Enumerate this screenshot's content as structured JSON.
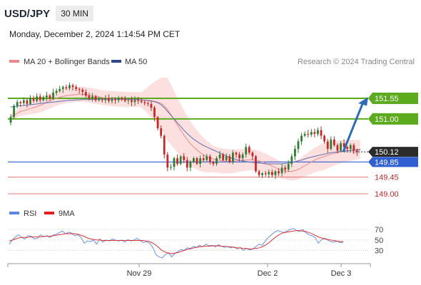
{
  "header": {
    "symbol": "USD/JPY",
    "timeframe": "30 MIN",
    "datetime": "Monday, December 2, 2024 1:14:54 PM CET"
  },
  "legend": {
    "ma20_bb_label": "MA 20 + Bollinger Bands",
    "ma50_label": "MA 50",
    "credit": "Research © 2024 Trading Central",
    "rsi_label": "RSI",
    "rsi_ma_label": "9MA"
  },
  "colors": {
    "bull": "#2e7d32",
    "bear": "#c62828",
    "ma20": "#e88a8a",
    "ma50": "#5a6fb5",
    "band_fill": "#fbd9d9",
    "resistance": "#5cab1e",
    "support": "#2f5fd0",
    "target_line": "#e05050",
    "arrow": "#2d6bb5",
    "rsi": "#5b86e5",
    "rsi_ma": "#e02020"
  },
  "chart_data": [
    {
      "type": "candlestick",
      "title": "USD/JPY 30 MIN",
      "x_tick_labels": [
        "Nov 29",
        "Dec 2",
        "Dec 3"
      ],
      "ylim": [
        148.7,
        152.3
      ],
      "levels": [
        {
          "value": 151.55,
          "label": "151.55",
          "kind": "resistance"
        },
        {
          "value": 151.0,
          "label": "151.00",
          "kind": "resistance"
        },
        {
          "value": 150.12,
          "label": "150.12",
          "kind": "current_price"
        },
        {
          "value": 149.85,
          "label": "149.85",
          "kind": "pivot_support"
        },
        {
          "value": 149.45,
          "label": "149.45",
          "kind": "support"
        },
        {
          "value": 149.0,
          "label": "149.00",
          "kind": "support"
        }
      ],
      "series": [
        {
          "name": "MA 20 + Bollinger Bands",
          "values": [
            151.05,
            151.1,
            151.15,
            151.2,
            151.22,
            151.25,
            151.28,
            151.3,
            151.33,
            151.36,
            151.4,
            151.45,
            151.48,
            151.52,
            151.55,
            151.58,
            151.6,
            151.62,
            151.63,
            151.64,
            151.65,
            151.66,
            151.66,
            151.65,
            151.63,
            151.62,
            151.6,
            151.59,
            151.57,
            151.56,
            151.55,
            151.54,
            151.54,
            151.53,
            151.53,
            151.52,
            151.52,
            151.52,
            151.52,
            151.52,
            151.51,
            151.5,
            151.5,
            151.49,
            151.47,
            151.45,
            151.42,
            151.35,
            151.25,
            151.12,
            150.98,
            150.84,
            150.7,
            150.57,
            150.45,
            150.34,
            150.25,
            150.17,
            150.1,
            150.04,
            149.99,
            149.96,
            149.93,
            149.91,
            149.89,
            149.88,
            149.87,
            149.87,
            149.87,
            149.88,
            149.89,
            149.9,
            149.9,
            149.91,
            149.91,
            149.9,
            149.88,
            149.85,
            149.82,
            149.78,
            149.74,
            149.7,
            149.66,
            149.63,
            149.61,
            149.6,
            149.6,
            149.62,
            149.65,
            149.7,
            149.75,
            149.8,
            149.85,
            149.9,
            149.94,
            149.97,
            150.0,
            150.03,
            150.06,
            150.08,
            150.1,
            150.12,
            150.14,
            150.15,
            150.16,
            150.17,
            150.18,
            150.19
          ]
        },
        {
          "name": "MA 50",
          "values": [
            151.32,
            151.33,
            151.34,
            151.35,
            151.36,
            151.37,
            151.38,
            151.39,
            151.4,
            151.41,
            151.42,
            151.43,
            151.44,
            151.45,
            151.46,
            151.47,
            151.48,
            151.49,
            151.5,
            151.5,
            151.51,
            151.51,
            151.52,
            151.52,
            151.52,
            151.52,
            151.53,
            151.53,
            151.53,
            151.53,
            151.53,
            151.53,
            151.53,
            151.53,
            151.53,
            151.53,
            151.53,
            151.52,
            151.52,
            151.52,
            151.51,
            151.5,
            151.49,
            151.48,
            151.46,
            151.43,
            151.38,
            151.3,
            151.2,
            151.1,
            151.0,
            150.9,
            150.8,
            150.7,
            150.61,
            150.53,
            150.46,
            150.4,
            150.34,
            150.29,
            150.25,
            150.21,
            150.17,
            150.13,
            150.09,
            150.05,
            150.01,
            149.97,
            149.94,
            149.92,
            149.9,
            149.88,
            149.86,
            149.85,
            149.84,
            149.83,
            149.82,
            149.81,
            149.8,
            149.8,
            149.8,
            149.8,
            149.8,
            149.8,
            149.81,
            149.82,
            149.84,
            149.86,
            149.88,
            149.9,
            149.93,
            149.96,
            149.98,
            150.0,
            150.02,
            150.04,
            150.06,
            150.08,
            150.1,
            150.11,
            150.12,
            150.13,
            150.14,
            150.15,
            150.16,
            150.16,
            150.17,
            150.17
          ]
        }
      ]
    },
    {
      "type": "line",
      "title": "RSI",
      "x_tick_labels": [
        "Nov 29",
        "Dec 2",
        "Dec 3"
      ],
      "ylim": [
        0,
        100
      ],
      "y_tick_labels": [
        "70",
        "50",
        "30"
      ],
      "y_ticks": [
        70,
        50,
        30
      ],
      "series": [
        {
          "name": "RSI",
          "values": [
            42,
            50,
            56,
            60,
            55,
            52,
            58,
            57,
            52,
            53,
            60,
            56,
            58,
            55,
            59,
            61,
            64,
            67,
            62,
            65,
            63,
            58,
            60,
            55,
            44,
            48,
            47,
            50,
            42,
            52,
            46,
            50,
            48,
            52,
            50,
            48,
            50,
            46,
            51,
            48,
            50,
            53,
            49,
            45,
            47,
            44,
            36,
            22,
            18,
            16,
            22,
            26,
            18,
            24,
            28,
            32,
            30,
            35,
            34,
            38,
            36,
            40,
            37,
            42,
            39,
            40,
            37,
            41,
            38,
            36,
            38,
            35,
            37,
            33,
            36,
            30,
            34,
            31,
            33,
            37,
            42,
            40,
            48,
            55,
            60,
            65,
            68,
            66,
            64,
            67,
            70,
            72,
            68,
            66,
            70,
            64,
            60,
            58,
            55,
            44,
            50,
            54,
            50,
            47,
            46,
            48,
            45,
            46
          ]
        },
        {
          "name": "9MA",
          "values": [
            48,
            50,
            52,
            54,
            55,
            55,
            55,
            56,
            56,
            56,
            56,
            57,
            57,
            57,
            58,
            59,
            60,
            61,
            62,
            62,
            62,
            62,
            61,
            59,
            57,
            54,
            52,
            51,
            50,
            50,
            49,
            49,
            49,
            49,
            49,
            49,
            49,
            49,
            49,
            49,
            49,
            49,
            49,
            49,
            48,
            47,
            44,
            40,
            35,
            30,
            27,
            25,
            24,
            25,
            26,
            28,
            30,
            32,
            33,
            35,
            36,
            37,
            38,
            38,
            38,
            39,
            39,
            39,
            38,
            38,
            37,
            37,
            36,
            35,
            35,
            34,
            34,
            33,
            33,
            34,
            35,
            37,
            40,
            44,
            49,
            54,
            58,
            62,
            64,
            65,
            66,
            67,
            68,
            68,
            67,
            66,
            64,
            62,
            59,
            56,
            54,
            52,
            51,
            50,
            49,
            48,
            47,
            47
          ]
        }
      ]
    }
  ]
}
